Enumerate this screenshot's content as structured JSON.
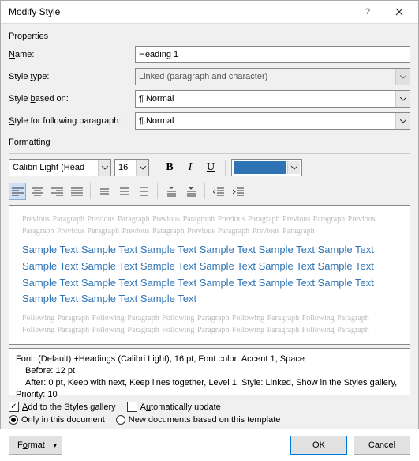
{
  "title": "Modify Style",
  "section_properties": "Properties",
  "section_formatting": "Formatting",
  "labels": {
    "name": "Name:",
    "style_type": "Style type:",
    "based_on": "Style based on:",
    "following": "Style for following paragraph:"
  },
  "values": {
    "name": "Heading 1",
    "style_type": "Linked (paragraph and character)",
    "based_on": "¶ Normal",
    "following": "¶ Normal",
    "font": "Calibri Light (Head",
    "size": "16"
  },
  "color_hex": "#2e74b5",
  "preview": {
    "prev": "Previous Paragraph Previous Paragraph Previous Paragraph Previous Paragraph Previous Paragraph Previous Paragraph Previous Paragraph Previous Paragraph Previous Paragraph Previous Paragraph",
    "sample": "Sample Text Sample Text Sample Text Sample Text Sample Text Sample Text Sample Text Sample Text Sample Text Sample Text Sample Text Sample Text Sample Text Sample Text Sample Text Sample Text Sample Text Sample Text Sample Text Sample Text Sample Text",
    "follow": "Following Paragraph Following Paragraph Following Paragraph Following Paragraph Following Paragraph Following Paragraph Following Paragraph Following Paragraph Following Paragraph Following Paragraph"
  },
  "desc": {
    "l1": "Font: (Default) +Headings (Calibri Light), 16 pt, Font color: Accent 1, Space",
    "l2": "Before:  12 pt",
    "l3": "After:  0 pt, Keep with next, Keep lines together, Level 1, Style: Linked, Show in the Styles gallery, Priority: 10"
  },
  "opts": {
    "add_gallery": "Add to the Styles gallery",
    "auto_update": "Automatically update",
    "only_doc": "Only in this document",
    "new_docs": "New documents based on this template"
  },
  "buttons": {
    "format": "Format",
    "ok": "OK",
    "cancel": "Cancel"
  }
}
